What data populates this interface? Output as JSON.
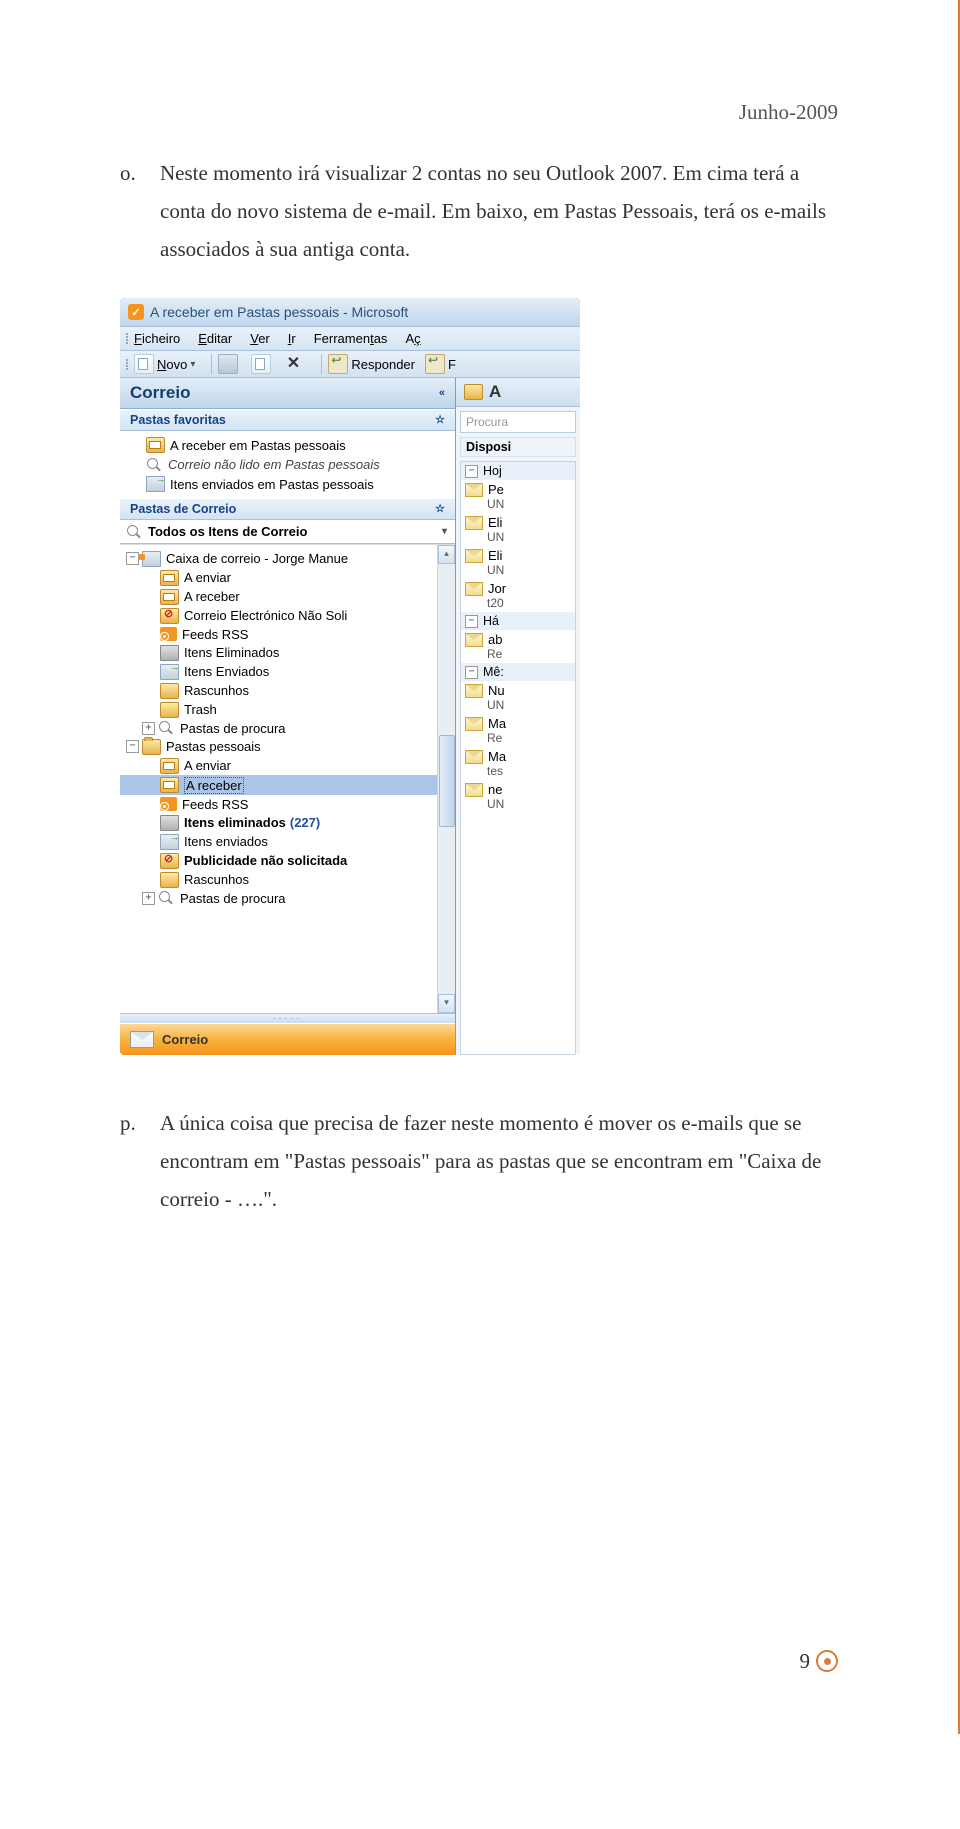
{
  "header": {
    "date": "Junho-2009"
  },
  "items": {
    "o": {
      "marker": "o.",
      "text": "Neste momento irá visualizar 2 contas no seu Outlook 2007. Em cima terá a conta do novo sistema de e-mail. Em baixo, em Pastas Pessoais, terá os e-mails associados à sua antiga conta."
    },
    "p": {
      "marker": "p.",
      "text": "A única coisa que precisa de fazer neste momento é mover os e-mails que se encontram em \"Pastas pessoais\" para as pastas que se encontram em \"Caixa de correio - ….\"."
    }
  },
  "outlook": {
    "title": "A receber em Pastas pessoais - Microsoft",
    "menu": {
      "ficheiro": "Ficheiro",
      "editar": "Editar",
      "ver": "Ver",
      "ir": "Ir",
      "ferramentas": "Ferramentas",
      "accoes": "Aç"
    },
    "toolbar": {
      "novo": "Novo",
      "responder": "Responder",
      "responder_f": "F"
    },
    "nav": {
      "title": "Correio",
      "fav_header": "Pastas favoritas",
      "favs": [
        {
          "icon": "inbox",
          "label": "A receber em Pastas pessoais"
        },
        {
          "icon": "search",
          "label": "Correio não lido em Pastas pessoais",
          "italic": true
        },
        {
          "icon": "sent",
          "label": "Itens enviados em Pastas pessoais"
        }
      ],
      "folders_header": "Pastas de Correio",
      "all_items": "Todos os Itens de Correio",
      "tree": {
        "mailbox": "Caixa de correio - Jorge Manue",
        "mb": {
          "enviar": "A enviar",
          "receber": "A receber",
          "junk": "Correio Electrónico Não Soli",
          "rss": "Feeds RSS",
          "del": "Itens Eliminados",
          "sent": "Itens Enviados",
          "draft": "Rascunhos",
          "trash": "Trash",
          "search": "Pastas de procura"
        },
        "personal": "Pastas pessoais",
        "pp": {
          "enviar": "A enviar",
          "receber": "A receber",
          "rss": "Feeds RSS",
          "del": "Itens eliminados",
          "del_count": "(227)",
          "sent": "Itens enviados",
          "junk": "Publicidade não solicitada",
          "draft": "Rascunhos",
          "search": "Pastas de procura"
        }
      },
      "button": "Correio"
    },
    "right": {
      "header": "A",
      "search": "Procura",
      "dispo": "Disposi",
      "grp_hoje": "Hoj",
      "msgs1": [
        {
          "l1": "Pe",
          "l2": "UN"
        },
        {
          "l1": "Eli",
          "l2": "UN"
        },
        {
          "l1": "Eli",
          "l2": "UN"
        },
        {
          "l1": "Jor",
          "l2": "t20"
        }
      ],
      "grp_ha": "Há ",
      "msgs2": [
        {
          "l1": "ab",
          "l2": "Re"
        }
      ],
      "grp_mes": "Mê:",
      "msgs3": [
        {
          "l1": "Nu",
          "l2": "UN"
        },
        {
          "l1": "Ma",
          "l2": "Re"
        },
        {
          "l1": "Ma",
          "l2": "tes"
        },
        {
          "l1": "ne",
          "l2": "UN"
        }
      ]
    }
  },
  "footer": {
    "page": "9"
  }
}
